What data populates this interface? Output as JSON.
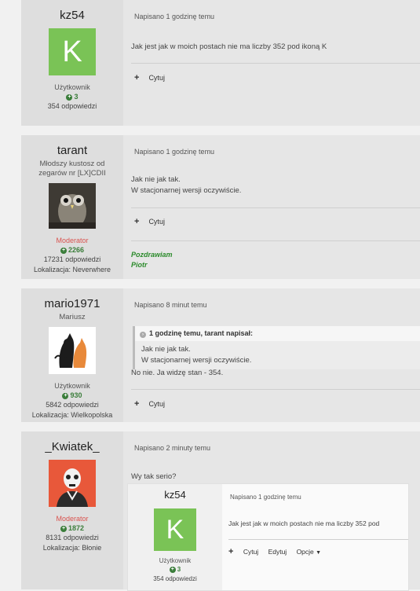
{
  "posts": [
    {
      "username": "kz54",
      "avatar_letter": "K",
      "group": "Użytkownik",
      "reputation": "3",
      "answers": "354 odpowiedzi",
      "date": "Napisano 1 godzinę temu",
      "body": "Jak jest jak w moich postach nie ma liczby 352 pod ikoną K",
      "quote_label": "Cytuj"
    },
    {
      "username": "tarant",
      "title": "Młodszy kustosz od zegarów nr [LX]CDII",
      "group": "Moderator",
      "reputation": "2266",
      "answers": "17231 odpowiedzi",
      "location": "Lokalizacja: Neverwhere",
      "date": "Napisano 1 godzinę temu",
      "body_line1": "Jak nie jak tak.",
      "body_line2": "W stacjonarnej wersji oczywiście.",
      "quote_label": "Cytuj",
      "sig_line1": "Pozdrawiam",
      "sig_line2": "Piotr"
    },
    {
      "username": "mario1971",
      "title": "Mariusz",
      "group": "Użytkownik",
      "reputation": "930",
      "answers": "5842 odpowiedzi",
      "location": "Lokalizacja: Wielkopolska",
      "date": "Napisano 8 minut temu",
      "quote_header": "1 godzinę temu, tarant napisał:",
      "quote_line1": "Jak nie jak tak.",
      "quote_line2": "W stacjonarnej wersji oczywiście.",
      "body": "No nie. Ja widzę stan - 354.",
      "quote_label": "Cytuj"
    },
    {
      "username": "_Kwiatek_",
      "group": "Moderator",
      "reputation": "1872",
      "answers": "8131 odpowiedzi",
      "location": "Lokalizacja: Błonie",
      "date": "Napisano 2 minuty temu",
      "body": "Wy tak serio?"
    }
  ],
  "nested": {
    "username": "kz54",
    "avatar_letter": "K",
    "group": "Użytkownik",
    "reputation": "3",
    "answers": "354 odpowiedzi",
    "date": "Napisano 1 godzinę temu",
    "body": "Jak jest jak w moich postach nie ma liczby 352 pod",
    "actions": [
      "Cytuj",
      "Edytuj",
      "Opcje"
    ]
  },
  "colors": {
    "avatar_green": "#7ac356",
    "moderator_red": "#d9534f",
    "rep_green": "#3a7d3a",
    "signature_green": "#2a8a2a"
  }
}
